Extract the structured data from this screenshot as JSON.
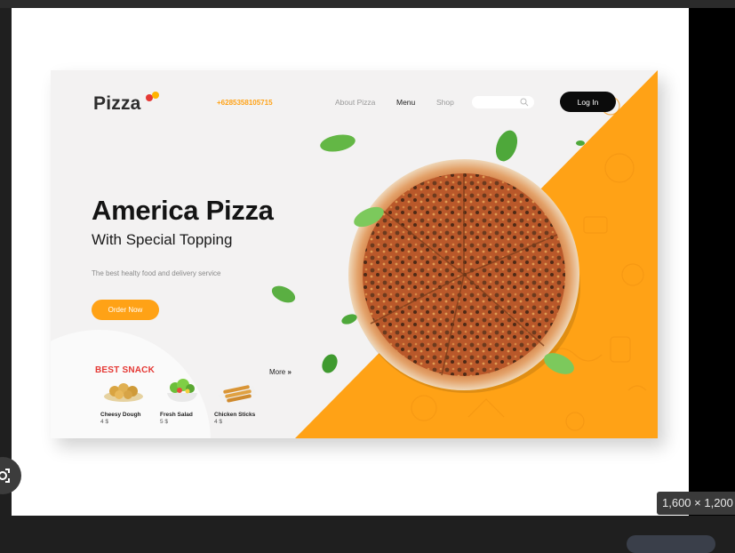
{
  "page": {
    "brand": "Pizza",
    "phone": "+6285358105715",
    "nav": {
      "about": "About Pizza",
      "menu": "Menu",
      "shop": "Shop"
    },
    "login_label": "Log In",
    "hero": {
      "title": "America Pizza",
      "subtitle": "With Special Topping",
      "description": "The best healty food and delivery service",
      "cta": "Order Now"
    },
    "snacks": {
      "heading": "BEST SNACK",
      "more": "More",
      "items": [
        {
          "name": "Cheesy Dough",
          "price": "4 $"
        },
        {
          "name": "Fresh Salad",
          "price": "5 $"
        },
        {
          "name": "Chicken Sticks",
          "price": "4 $"
        }
      ]
    }
  },
  "viewer": {
    "dimensions": "1,600 × 1,200"
  },
  "colors": {
    "accent": "#ffa216",
    "brand_red": "#e53935",
    "dark": "#0b0b0b",
    "leaf": "#5cb85c"
  }
}
